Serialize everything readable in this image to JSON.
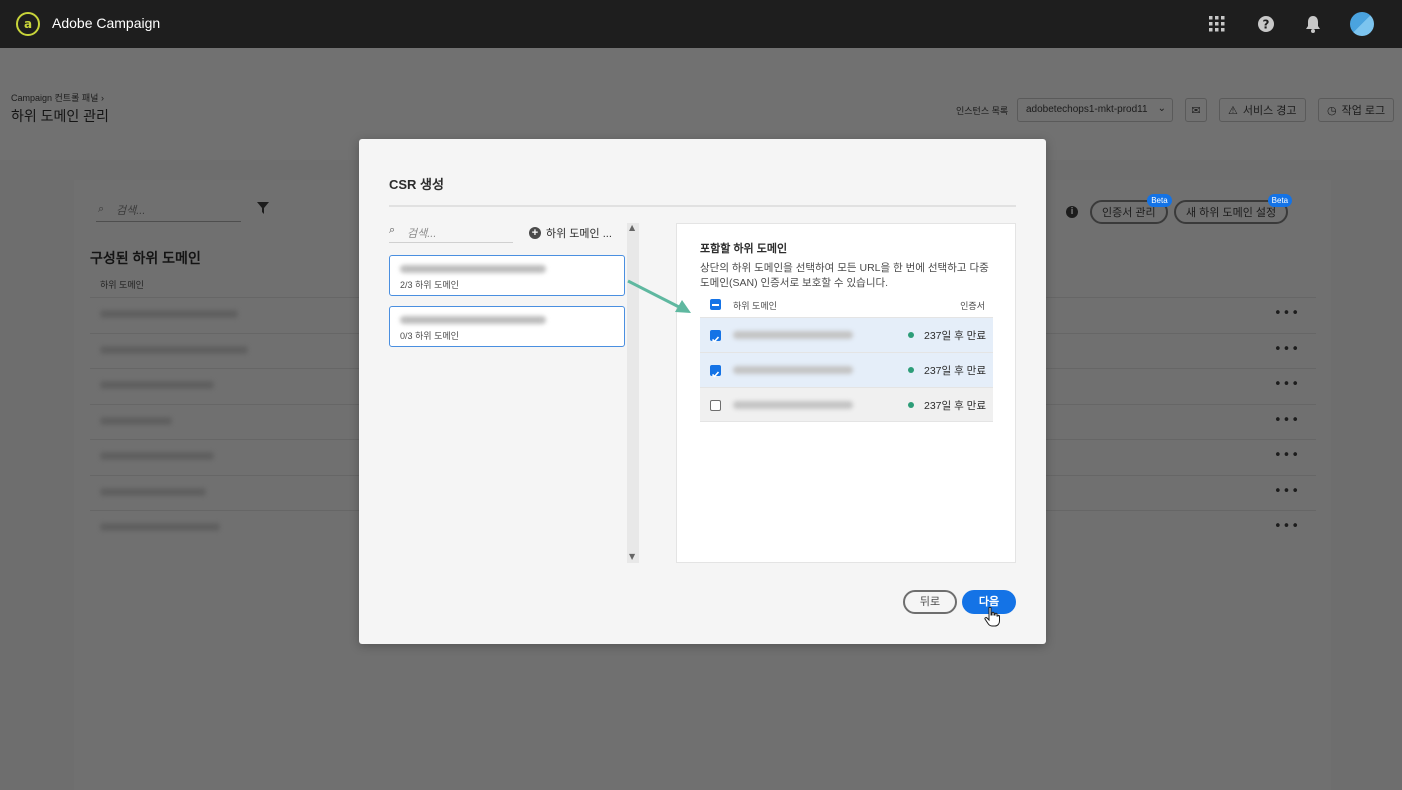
{
  "app": {
    "title": "Adobe Campaign",
    "logo_glyph": "a"
  },
  "topbar": {
    "icons": [
      "apps-grid-icon",
      "help-icon",
      "bell-icon"
    ]
  },
  "header": {
    "breadcrumb": "Campaign 컨트롤 패널",
    "breadcrumb_separator": "›",
    "page_title": "하위 도메인 관리",
    "instance_label": "인스턴스 목록",
    "instance_value": "adobetechops1-mkt-prod11",
    "service_alert": "서비스 경고",
    "job_log": "작업 로그"
  },
  "background": {
    "search_placeholder": "검색...",
    "section_title": "구성된 하위 도메인",
    "column_header": "하위 도메인",
    "row_count": 7,
    "cert_manage": "인증서 관리",
    "new_subdomain": "새 하위 도메인 설정",
    "beta": "Beta"
  },
  "modal": {
    "title": "CSR 생성",
    "search_placeholder": "검색...",
    "add_subdomain": "하위 도메인 ...",
    "domains": [
      {
        "count": "2/3 하위 도메인"
      },
      {
        "count": "0/3 하위 도메인"
      }
    ],
    "right": {
      "title": "포함할 하위 도메인",
      "description": "상단의 하위 도메인을 선택하여 모든 URL을 한 번에 선택하고 다중 도메인(SAN) 인증서로 보호할 수 있습니다.",
      "col_subdomain": "하위 도메인",
      "col_cert": "인증서",
      "rows": [
        {
          "checked": true,
          "expiry": "237일 후 만료"
        },
        {
          "checked": true,
          "expiry": "237일 후 만료"
        },
        {
          "checked": false,
          "expiry": "237일 후 만료"
        }
      ]
    },
    "back": "뒤로",
    "next": "다음"
  },
  "colors": {
    "accent": "#1473e6",
    "status_green": "#2d9d78",
    "arrow": "#5fb8a0"
  }
}
